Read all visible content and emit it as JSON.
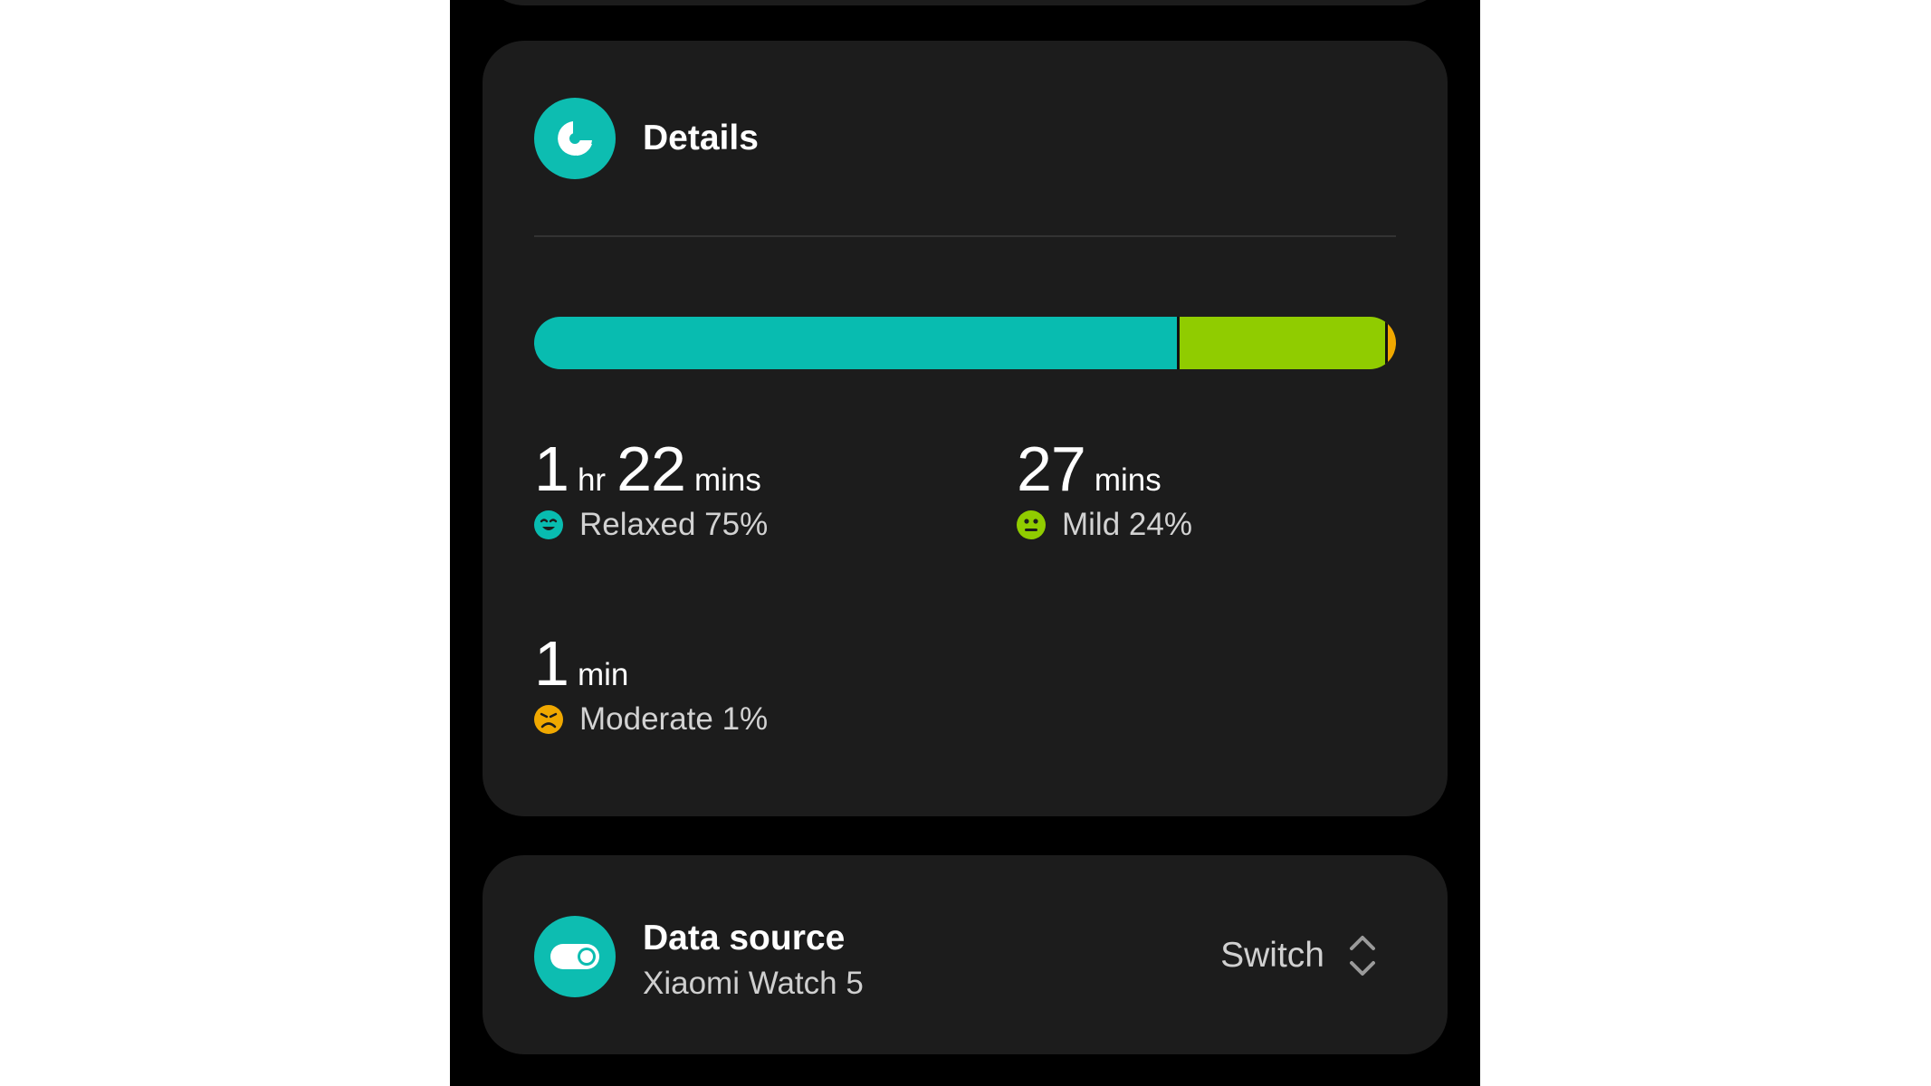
{
  "details": {
    "title": "Details",
    "icon": "pie-chart-icon",
    "distribution": {
      "relaxed_percent": 75,
      "mild_percent": 24,
      "moderate_percent": 1
    },
    "stats": {
      "relaxed": {
        "value1": "1",
        "unit1": "hr",
        "value2": "22",
        "unit2": "mins",
        "label": "Relaxed 75%",
        "icon": "relaxed-face-icon",
        "color": "#08bcb0"
      },
      "mild": {
        "value1": "27",
        "unit1": "mins",
        "label": "Mild 24%",
        "icon": "mild-face-icon",
        "color": "#90cc00"
      },
      "moderate": {
        "value1": "1",
        "unit1": "min",
        "label": "Moderate 1%",
        "icon": "moderate-face-icon",
        "color": "#f0a800"
      }
    }
  },
  "data_source": {
    "title": "Data source",
    "device": "Xiaomi Watch 5",
    "switch_label": "Switch",
    "icon": "data-source-toggle-icon",
    "switch_icon": "unfold-chevrons-icon"
  },
  "colors": {
    "accent": "#0dbdb1",
    "card_bg": "#1c1c1c",
    "background": "#000000"
  }
}
